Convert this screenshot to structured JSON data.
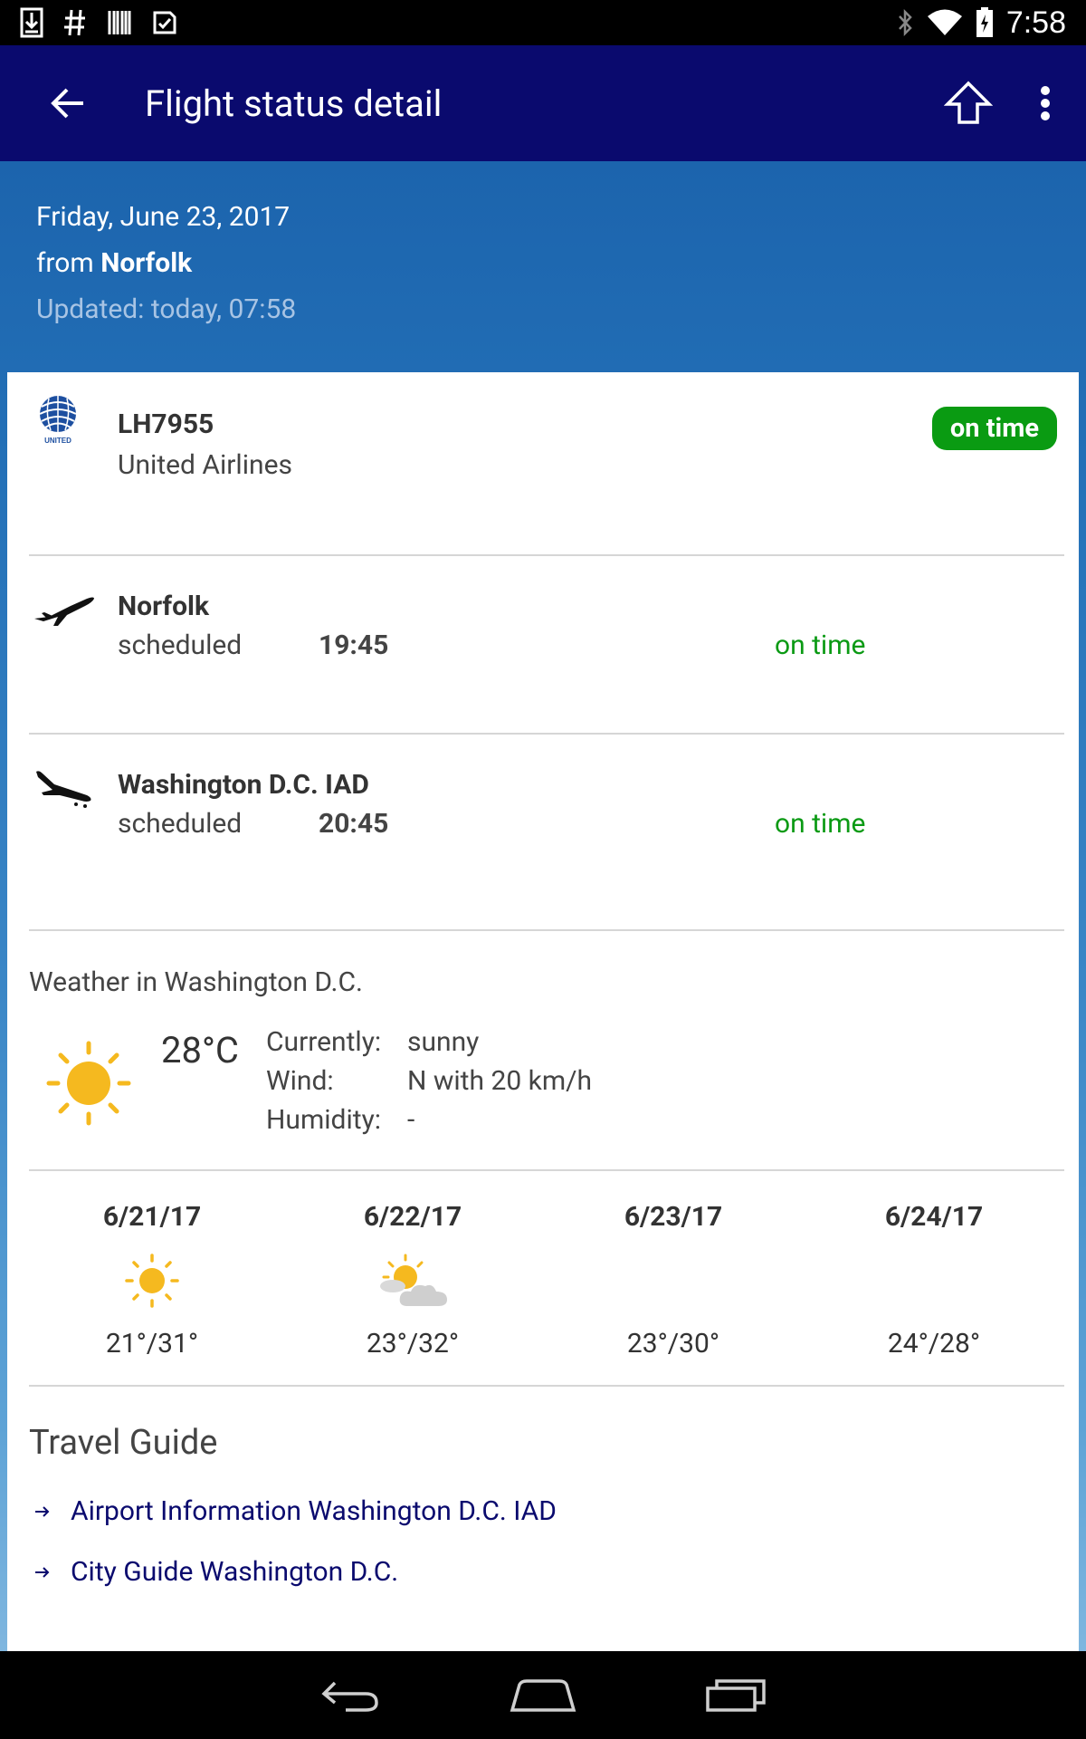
{
  "status_bar": {
    "time": "7:58",
    "icons_left": [
      "download-icon",
      "hashtag-icon",
      "barcode-icon",
      "tasks-icon"
    ],
    "icons_right": [
      "bluetooth-icon",
      "wifi-icon",
      "battery-icon"
    ]
  },
  "app_bar": {
    "title": "Flight status detail"
  },
  "header": {
    "date": "Friday, June 23, 2017",
    "from_prefix": "from",
    "from_city": "Norfolk",
    "updated": "Updated: today, 07:58"
  },
  "flight": {
    "number": "LH7955",
    "airline": "United Airlines",
    "status": "on time",
    "status_color": "#0a9b12"
  },
  "legs": [
    {
      "city": "Norfolk",
      "label": "scheduled",
      "time": "19:45",
      "status": "on time",
      "icon": "takeoff-icon"
    },
    {
      "city": "Washington D.C. IAD",
      "label": "scheduled",
      "time": "20:45",
      "status": "on time",
      "icon": "landing-icon"
    }
  ],
  "weather": {
    "title": "Weather in Washington D.C.",
    "temp": "28°C",
    "rows": [
      {
        "label": "Currently:",
        "value": "sunny"
      },
      {
        "label": "Wind:",
        "value": "N with 20 km/h"
      },
      {
        "label": "Humidity:",
        "value": "-"
      }
    ],
    "forecast": [
      {
        "date": "6/21/17",
        "temps": "21°/31°",
        "icon": "sun-icon"
      },
      {
        "date": "6/22/17",
        "temps": "23°/32°",
        "icon": "partly-cloudy-icon"
      },
      {
        "date": "6/23/17",
        "temps": "23°/30°",
        "icon": ""
      },
      {
        "date": "6/24/17",
        "temps": "24°/28°",
        "icon": ""
      }
    ]
  },
  "travel_guide": {
    "title": "Travel Guide",
    "links": [
      "Airport Information Washington D.C. IAD",
      "City Guide Washington D.C."
    ]
  },
  "colors": {
    "app_bar": "#0a0a6e",
    "on_time": "#0b9a14",
    "link": "#0a0a6e"
  }
}
